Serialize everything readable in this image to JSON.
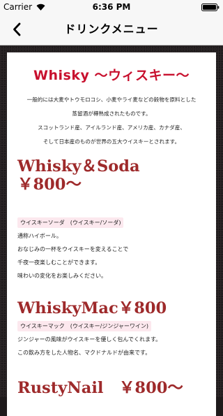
{
  "status_bar": {
    "carrier": "Carrier",
    "time": "6:36 PM"
  },
  "nav": {
    "title": "ドリンクメニュー"
  },
  "section": {
    "heading": "Whisky 〜ウィスキー〜",
    "intro": [
      "一般的には大麦やトウモロコシ、小麦やライ麦などの穀物を原料とした",
      "蒸留酒が樽熟成されたものです。",
      "スコットランド産、アイルランド産、アメリカ産、カナダ産、",
      "そして日本産のものが世界の五大ウイスキーとされます。"
    ]
  },
  "drinks": [
    {
      "name": "Whisky＆Soda　￥800〜",
      "reading": "ウイスキーソーダ　(ウイスキー/ソーダ)",
      "description": [
        "通称ハイボール。",
        "おなじみの一杯をウイスキーを変えることで",
        "千夜一夜楽しむことができます。",
        "味わいの変化をお楽しみください。"
      ]
    },
    {
      "name": "WhiskyMac￥800",
      "reading": "ウイスキーマック　(ウイスキー/ジンジャーワイン)",
      "description": [
        "ジンジャーの風味がウイスキーを優しく包んでくれます。",
        "この飲み方をした人物名、マクドナルドが由来です。"
      ]
    },
    {
      "name": "RustyNail　￥800〜"
    }
  ]
}
